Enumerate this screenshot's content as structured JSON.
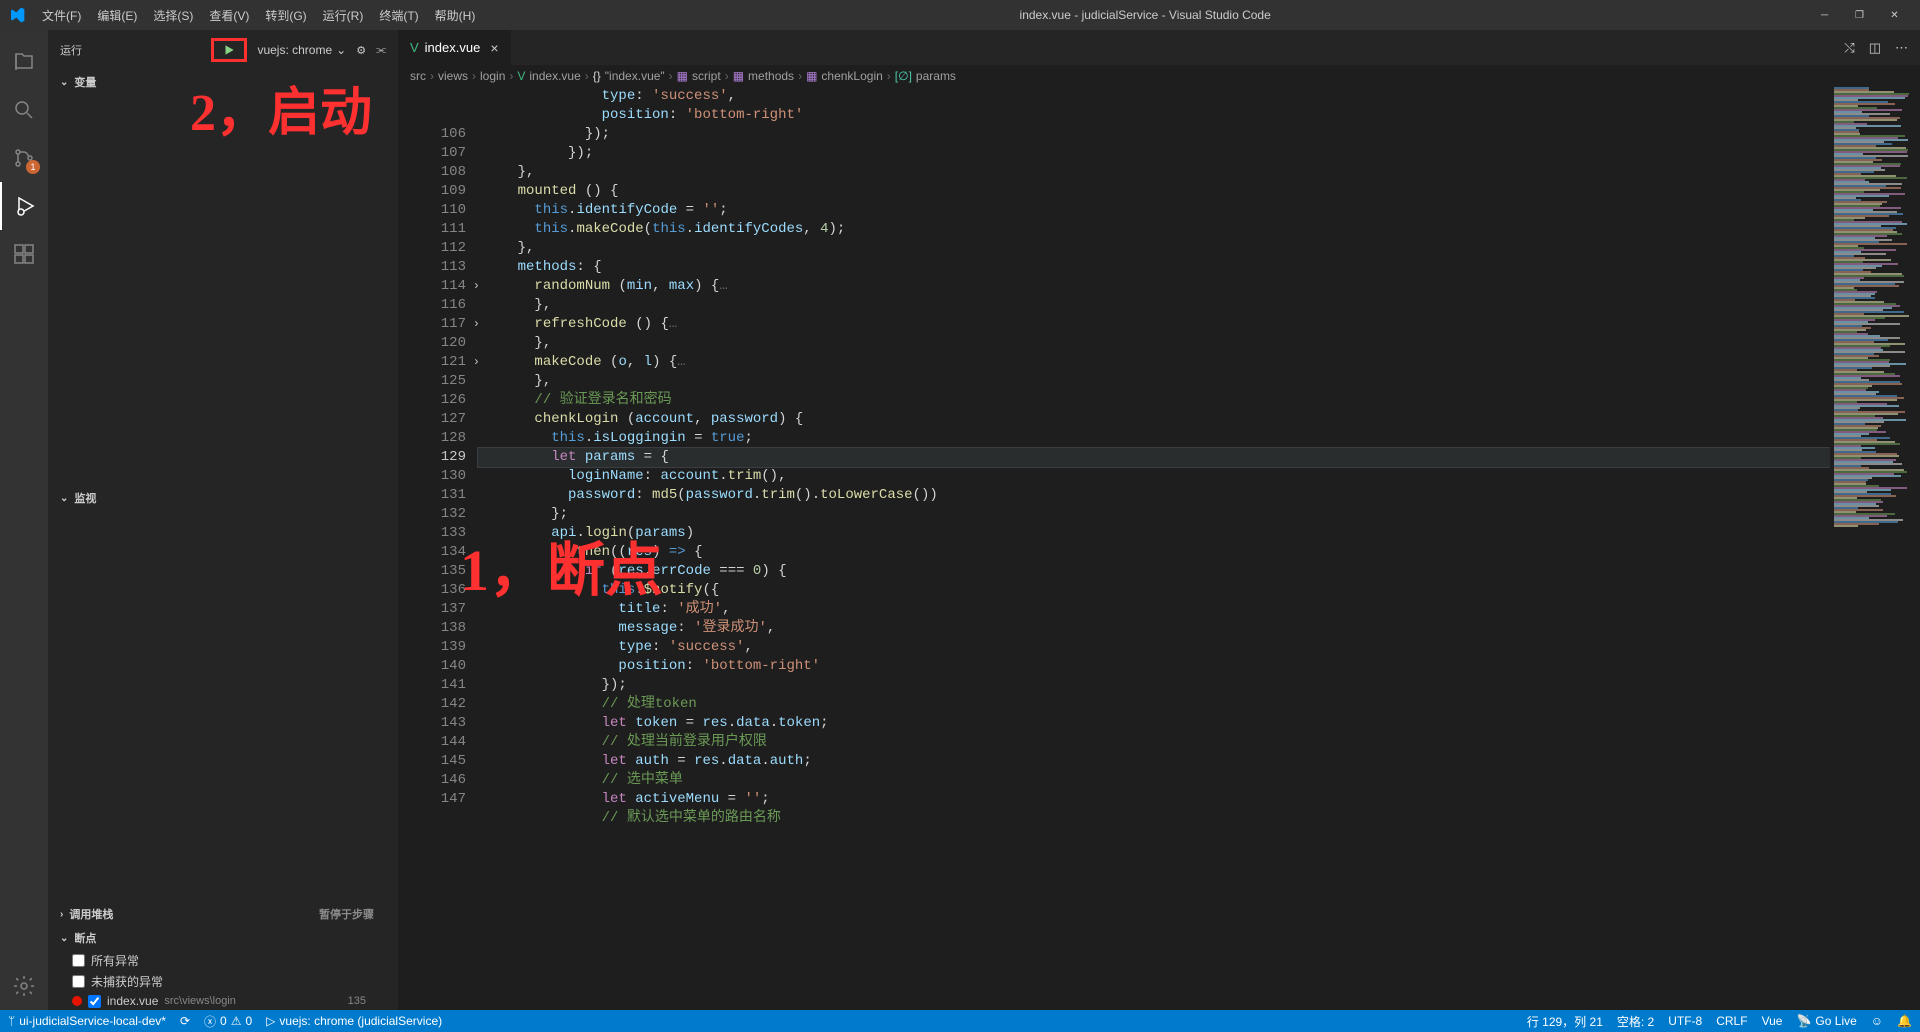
{
  "titlebar": {
    "menus": [
      "文件(F)",
      "编辑(E)",
      "选择(S)",
      "查看(V)",
      "转到(G)",
      "运行(R)",
      "终端(T)",
      "帮助(H)"
    ],
    "title": "index.vue - judicialService - Visual Studio Code"
  },
  "activity": {
    "badge": "1"
  },
  "sidebar": {
    "run_label": "运行",
    "config": "vuejs: chrome",
    "sections": {
      "variables": "变量",
      "watch": "监视",
      "callstack": "调用堆栈",
      "callstack_status": "暂停于步骤",
      "breakpoints": "断点"
    },
    "bp_all_exceptions": "所有异常",
    "bp_uncaught": "未捕获的异常",
    "bp_file": "index.vue",
    "bp_path": "src\\views\\login",
    "bp_file_line": "135"
  },
  "tab": {
    "name": "index.vue"
  },
  "breadcrumb": [
    "src",
    "views",
    "login",
    "index.vue",
    "\"index.vue\"",
    "script",
    "methods",
    "chenkLogin",
    "params"
  ],
  "bc_icons": [
    "",
    "",
    "",
    "V",
    "{}",
    "▦",
    "▦",
    "▦",
    "[∅]"
  ],
  "bc_icon_colors": [
    "",
    "",
    "",
    "#41b883",
    "#d4d4d4",
    "#b180d7",
    "#b180d7",
    "#b180d7",
    "#4ec9b0"
  ],
  "code": [
    {
      "n": "",
      "html": "              <span class='tk-prop'>type</span><span class='tk-p'>:</span> <span class='tk-str'>'success'</span><span class='tk-p'>,</span>"
    },
    {
      "n": "",
      "html": "              <span class='tk-prop'>position</span><span class='tk-p'>:</span> <span class='tk-str'>'bottom-right'</span>"
    },
    {
      "n": "106",
      "html": "            <span class='tk-p'>});</span>"
    },
    {
      "n": "107",
      "html": "          <span class='tk-p'>});</span>"
    },
    {
      "n": "108",
      "html": "    <span class='tk-p'>},</span>"
    },
    {
      "n": "109",
      "html": "    <span class='tk-fn'>mounted</span> <span class='tk-p'>() {</span>"
    },
    {
      "n": "110",
      "html": "      <span class='tk-this'>this</span><span class='tk-p'>.</span><span class='tk-prop'>identifyCode</span> <span class='tk-op'>=</span> <span class='tk-str'>''</span><span class='tk-p'>;</span>"
    },
    {
      "n": "111",
      "html": "      <span class='tk-this'>this</span><span class='tk-p'>.</span><span class='tk-fn'>makeCode</span><span class='tk-p'>(</span><span class='tk-this'>this</span><span class='tk-p'>.</span><span class='tk-prop'>identifyCodes</span><span class='tk-p'>,</span> <span class='tk-num'>4</span><span class='tk-p'>);</span>"
    },
    {
      "n": "112",
      "html": "    <span class='tk-p'>},</span>"
    },
    {
      "n": "113",
      "html": "    <span class='tk-prop'>methods</span><span class='tk-p'>: {</span>"
    },
    {
      "n": "114",
      "fold": true,
      "html": "      <span class='tk-fn'>randomNum</span> <span class='tk-p'>(</span><span class='tk-param'>min</span><span class='tk-p'>,</span> <span class='tk-param'>max</span><span class='tk-p'>) {</span><span class='tk-dim'>…</span>"
    },
    {
      "n": "116",
      "html": "      <span class='tk-p'>},</span>"
    },
    {
      "n": "117",
      "fold": true,
      "html": "      <span class='tk-fn'>refreshCode</span> <span class='tk-p'>() {</span><span class='tk-dim'>…</span>"
    },
    {
      "n": "120",
      "html": "      <span class='tk-p'>},</span>"
    },
    {
      "n": "121",
      "fold": true,
      "html": "      <span class='tk-fn'>makeCode</span> <span class='tk-p'>(</span><span class='tk-param'>o</span><span class='tk-p'>,</span> <span class='tk-param'>l</span><span class='tk-p'>) {</span><span class='tk-dim'>…</span>"
    },
    {
      "n": "125",
      "html": "      <span class='tk-p'>},</span>"
    },
    {
      "n": "126",
      "html": "      <span class='tk-cmt'>// 验证登录名和密码</span>"
    },
    {
      "n": "127",
      "html": "      <span class='tk-fn'>chenkLogin</span> <span class='tk-p'>(</span><span class='tk-param'>account</span><span class='tk-p'>,</span> <span class='tk-param'>password</span><span class='tk-p'>) {</span>"
    },
    {
      "n": "128",
      "html": "        <span class='tk-this'>this</span><span class='tk-p'>.</span><span class='tk-prop'>isLoggingin</span> <span class='tk-op'>=</span> <span class='tk-k'>true</span><span class='tk-p'>;</span>"
    },
    {
      "n": "129",
      "current": true,
      "html": "        <span class='tk-kw'>let</span> <span class='tk-var'>params</span> <span class='tk-op'>=</span> <span class='tk-p'>{</span>"
    },
    {
      "n": "130",
      "html": "          <span class='tk-prop'>loginName</span><span class='tk-p'>:</span> <span class='tk-var'>account</span><span class='tk-p'>.</span><span class='tk-fn'>trim</span><span class='tk-p'>(),</span>"
    },
    {
      "n": "131",
      "html": "          <span class='tk-prop'>password</span><span class='tk-p'>:</span> <span class='tk-fn'>md5</span><span class='tk-p'>(</span><span class='tk-var'>password</span><span class='tk-p'>.</span><span class='tk-fn'>trim</span><span class='tk-p'>().</span><span class='tk-fn'>toLowerCase</span><span class='tk-p'>())</span>"
    },
    {
      "n": "132",
      "html": "        <span class='tk-p'>};</span>"
    },
    {
      "n": "133",
      "html": "        <span class='tk-var'>api</span><span class='tk-p'>.</span><span class='tk-fn'>login</span><span class='tk-p'>(</span><span class='tk-var'>params</span><span class='tk-p'>)</span>"
    },
    {
      "n": "134",
      "html": "          <span class='tk-p'>.</span><span class='tk-fn'>then</span><span class='tk-p'>((</span><span class='tk-param'>res</span><span class='tk-p'>) </span><span class='tk-k'>=&gt;</span><span class='tk-p'> {</span>"
    },
    {
      "n": "135",
      "bp": true,
      "html": "            <span class='tk-kw'>if</span> <span class='tk-p'>(</span><span class='tk-var'>res</span><span class='tk-p'>.</span><span class='tk-prop'>errCode</span> <span class='tk-op'>===</span> <span class='tk-num'>0</span><span class='tk-p'>) {</span>"
    },
    {
      "n": "136",
      "html": "              <span class='tk-this'>this</span><span class='tk-p'>.</span><span class='tk-fn'>$notify</span><span class='tk-p'>({</span>"
    },
    {
      "n": "137",
      "html": "                <span class='tk-prop'>title</span><span class='tk-p'>:</span> <span class='tk-str'>'成功'</span><span class='tk-p'>,</span>"
    },
    {
      "n": "138",
      "html": "                <span class='tk-prop'>message</span><span class='tk-p'>:</span> <span class='tk-str'>'登录成功'</span><span class='tk-p'>,</span>"
    },
    {
      "n": "139",
      "html": "                <span class='tk-prop'>type</span><span class='tk-p'>:</span> <span class='tk-str'>'success'</span><span class='tk-p'>,</span>"
    },
    {
      "n": "140",
      "html": "                <span class='tk-prop'>position</span><span class='tk-p'>:</span> <span class='tk-str'>'bottom-right'</span>"
    },
    {
      "n": "141",
      "html": "              <span class='tk-p'>});</span>"
    },
    {
      "n": "142",
      "html": "              <span class='tk-cmt'>// 处理token</span>"
    },
    {
      "n": "143",
      "html": "              <span class='tk-kw'>let</span> <span class='tk-var'>token</span> <span class='tk-op'>=</span> <span class='tk-var'>res</span><span class='tk-p'>.</span><span class='tk-prop'>data</span><span class='tk-p'>.</span><span class='tk-prop'>token</span><span class='tk-p'>;</span>"
    },
    {
      "n": "144",
      "html": "              <span class='tk-cmt'>// 处理当前登录用户权限</span>"
    },
    {
      "n": "145",
      "html": "              <span class='tk-kw'>let</span> <span class='tk-var'>auth</span> <span class='tk-op'>=</span> <span class='tk-var'>res</span><span class='tk-p'>.</span><span class='tk-prop'>data</span><span class='tk-p'>.</span><span class='tk-prop'>auth</span><span class='tk-p'>;</span>"
    },
    {
      "n": "146",
      "html": "              <span class='tk-cmt'>// 选中菜单</span>"
    },
    {
      "n": "147",
      "html": "              <span class='tk-kw'>let</span> <span class='tk-var'>activeMenu</span> <span class='tk-op'>=</span> <span class='tk-str'>''</span><span class='tk-p'>;</span>"
    },
    {
      "n": "",
      "html": "              <span class='tk-cmt'>// 默认选中菜单的路由名称</span>"
    }
  ],
  "statusbar": {
    "branch": "ui-judicialService-local-dev*",
    "errors": "0",
    "warnings": "0",
    "debug": "vuejs: chrome (judicialService)",
    "lncol": "行 129，列 21",
    "spaces": "空格: 2",
    "encoding": "UTF-8",
    "eol": "CRLF",
    "lang": "Vue",
    "golive": "Go Live"
  },
  "annotations": {
    "text1": "2，启动",
    "text2": "1，断点"
  }
}
